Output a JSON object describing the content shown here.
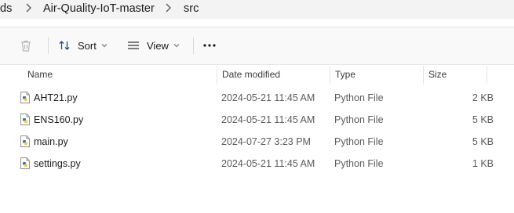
{
  "breadcrumb": {
    "items": [
      "ds",
      "Air-Quality-IoT-master",
      "src"
    ]
  },
  "toolbar": {
    "sort_label": "Sort",
    "view_label": "View",
    "more_label": "···"
  },
  "columns": {
    "name": "Name",
    "date": "Date modified",
    "type": "Type",
    "size": "Size"
  },
  "files": [
    {
      "name": "AHT21.py",
      "date": "2024-05-21 11:45 AM",
      "type": "Python File",
      "size": "2 KB"
    },
    {
      "name": "ENS160.py",
      "date": "2024-05-21 11:45 AM",
      "type": "Python File",
      "size": "5 KB"
    },
    {
      "name": "main.py",
      "date": "2024-07-27 3:23 PM",
      "type": "Python File",
      "size": "5 KB"
    },
    {
      "name": "settings.py",
      "date": "2024-05-21 11:45 AM",
      "type": "Python File",
      "size": "1 KB"
    }
  ],
  "icons": {
    "file": "python-file-icon",
    "delete": "trash-icon",
    "sort": "sort-arrows-icon",
    "view": "view-lines-icon",
    "chevron": "chevron-right-icon"
  },
  "colors": {
    "python_blue": "#3776ab",
    "python_yellow": "#f7c948"
  }
}
